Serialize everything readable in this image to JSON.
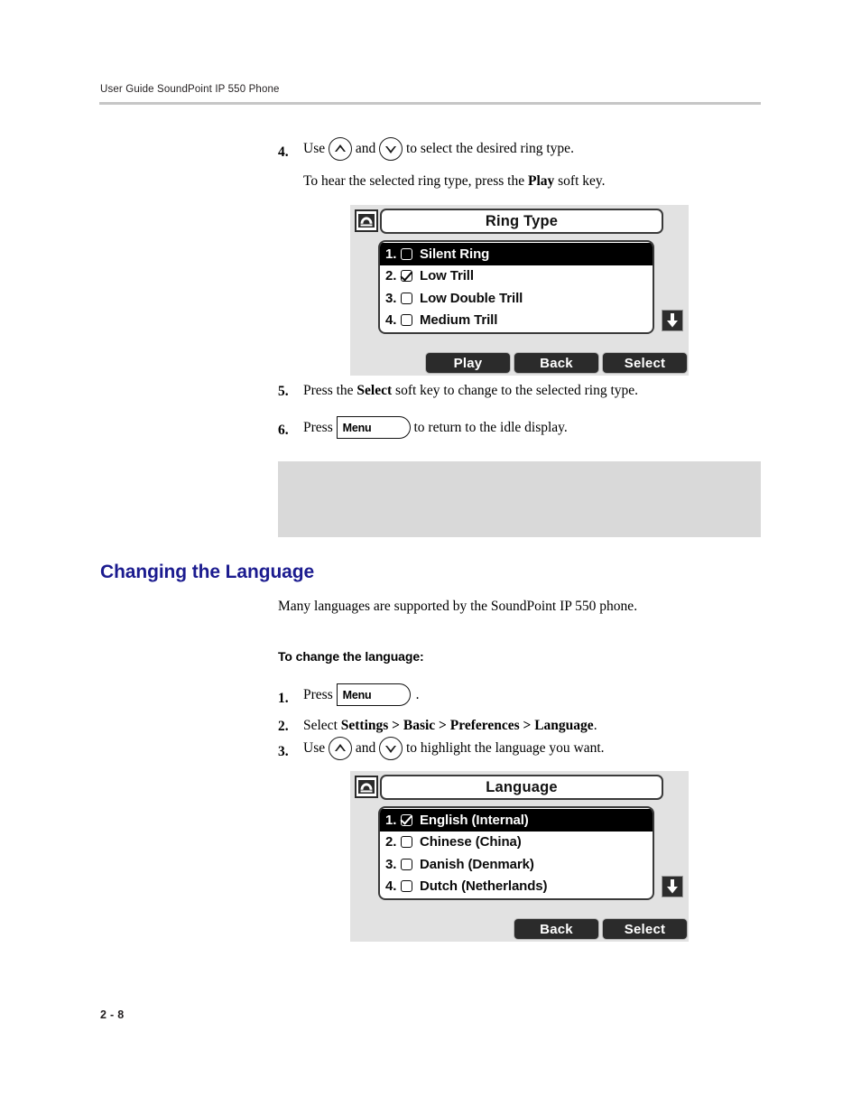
{
  "header": {
    "running_head": "User Guide SoundPoint IP 550 Phone"
  },
  "footer": {
    "page_number": "2 - 8"
  },
  "colors": {
    "heading_blue": "#1b1b8f",
    "rule_gray": "#c6c6c6",
    "note_gray": "#d9d9d9",
    "lcd_bezel": "#e2e2e2",
    "softkey_dark": "#2b2b2b"
  },
  "ring_type_section": {
    "step4": {
      "number": "4.",
      "lead": "Use ",
      "mid": " and ",
      "tail": " to select the desired ring type.",
      "up_key_name": "up-arrow-key",
      "down_key_name": "down-arrow-key",
      "second_line_pre": "To hear the selected ring type, press the ",
      "second_line_bold": "Play",
      "second_line_post": " soft key."
    },
    "step5": {
      "number": "5.",
      "pre": "Press the ",
      "bold": "Select",
      "post": " soft key to change to the selected ring type."
    },
    "step6": {
      "number": "6.",
      "pre": "Press ",
      "menu_key_label": "Menu",
      "post": " to return to the idle display."
    }
  },
  "ring_type_screen": {
    "title": "Ring Type",
    "phone_icon": "phone-handset-icon",
    "scroll_indicator": "scroll-down-arrow-icon",
    "items": [
      {
        "index": "1.",
        "label": "Silent Ring",
        "checked": false,
        "selected": true
      },
      {
        "index": "2.",
        "label": "Low Trill",
        "checked": true,
        "selected": false
      },
      {
        "index": "3.",
        "label": "Low Double Trill",
        "checked": false,
        "selected": false
      },
      {
        "index": "4.",
        "label": "Medium Trill",
        "checked": false,
        "selected": false
      }
    ],
    "softkeys": [
      "Play",
      "Back",
      "Select"
    ]
  },
  "language_section": {
    "heading": "Changing the Language",
    "intro": "Many languages are supported by the SoundPoint IP 550 phone.",
    "sub_heading": "To change the language:",
    "step1": {
      "number": "1.",
      "pre": "Press ",
      "menu_key_label": "Menu",
      "post": "."
    },
    "step2": {
      "number": "2.",
      "pre": "Select ",
      "bold": "Settings > Basic > Preferences > Language",
      "post": "."
    },
    "step3": {
      "number": "3.",
      "lead": "Use ",
      "mid": " and ",
      "tail": " to highlight the language you want.",
      "up_key_name": "up-arrow-key",
      "down_key_name": "down-arrow-key"
    }
  },
  "language_screen": {
    "title": "Language",
    "phone_icon": "phone-handset-icon",
    "scroll_indicator": "scroll-down-arrow-icon",
    "items": [
      {
        "index": "1.",
        "label": "English (Internal)",
        "checked": true,
        "selected": true
      },
      {
        "index": "2.",
        "label": "Chinese (China)",
        "checked": false,
        "selected": false
      },
      {
        "index": "3.",
        "label": "Danish (Denmark)",
        "checked": false,
        "selected": false
      },
      {
        "index": "4.",
        "label": "Dutch (Netherlands)",
        "checked": false,
        "selected": false
      }
    ],
    "softkeys": [
      "Back",
      "Select"
    ]
  }
}
